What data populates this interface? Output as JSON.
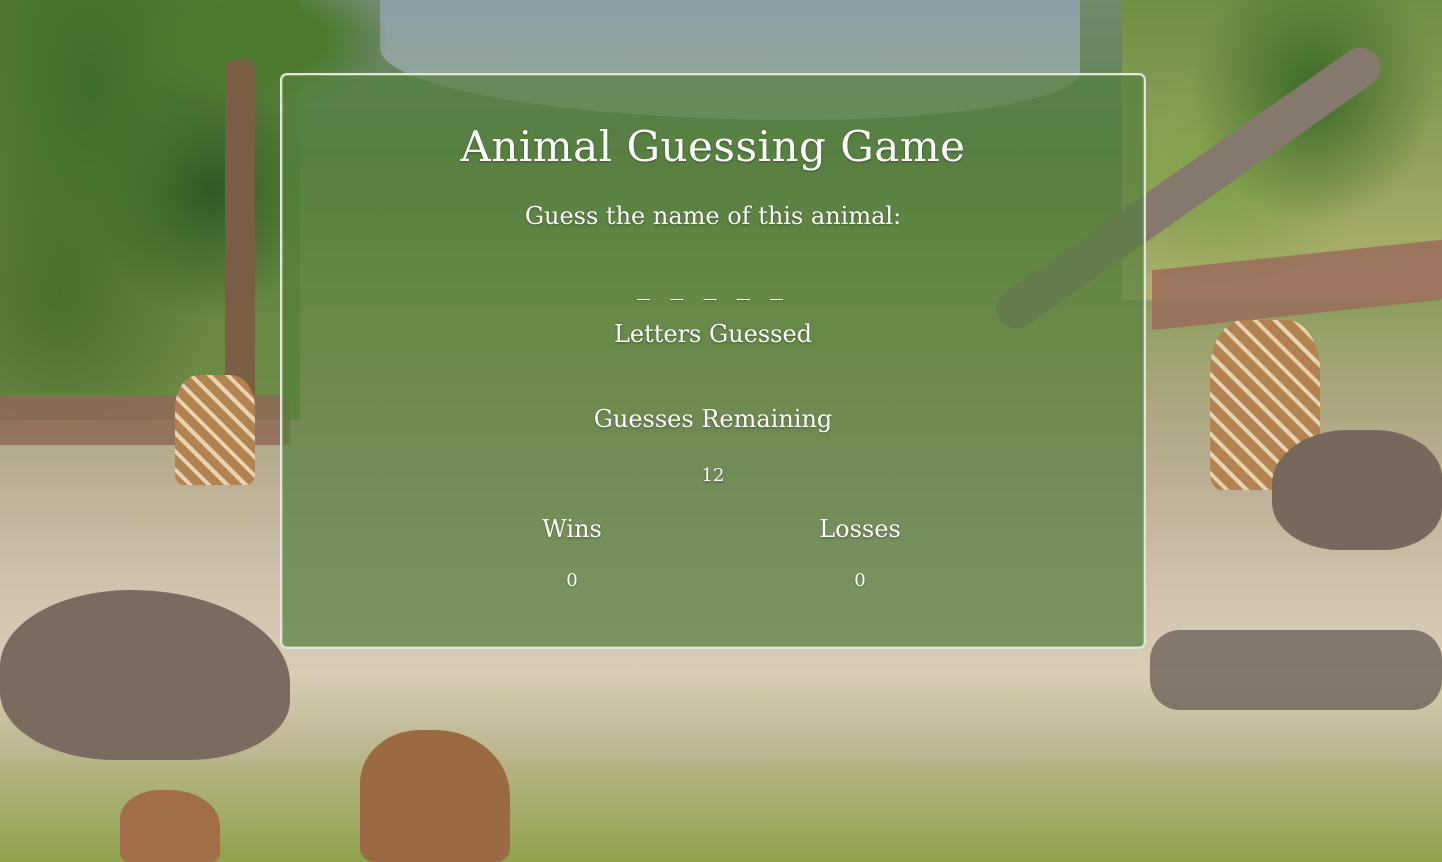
{
  "game": {
    "title": "Animal Guessing Game",
    "prompt": "Guess the name of this animal:",
    "word_display": "_ _ _ _ _",
    "letters_guessed_label": "Letters Guessed",
    "letters_guessed": "",
    "guesses_remaining_label": "Guesses Remaining",
    "guesses_remaining": "12",
    "wins_label": "Wins",
    "wins": "0",
    "losses_label": "Losses",
    "losses": "0"
  },
  "colors": {
    "panel_overlay": "#56803e",
    "panel_border": "#dfe7d6",
    "text": "#ffffff"
  }
}
